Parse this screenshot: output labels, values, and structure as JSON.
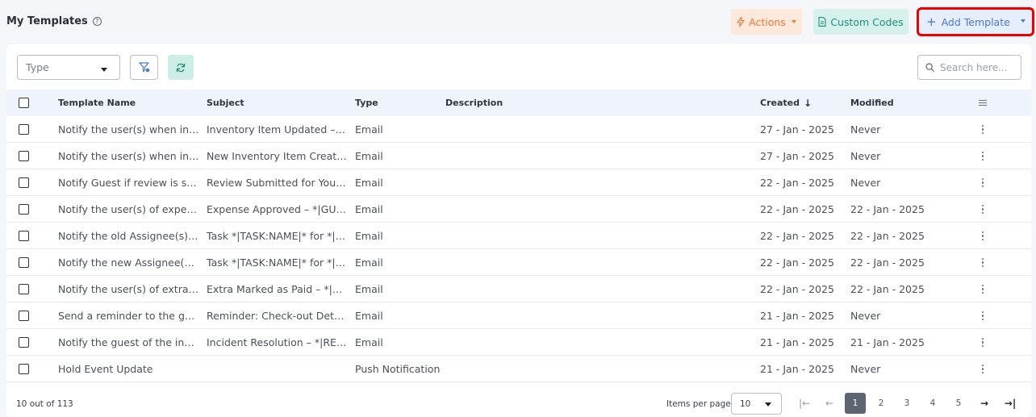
{
  "header": {
    "title": "My Templates",
    "help_glyph": "?",
    "actions_label": "Actions",
    "custom_codes_label": "Custom Codes",
    "add_template_label": "Add Template",
    "add_template_plus": "+"
  },
  "toolbar": {
    "type_placeholder": "Type",
    "search_placeholder": "Search here..."
  },
  "table": {
    "columns": {
      "name": "Template Name",
      "subject": "Subject",
      "type": "Type",
      "description": "Description",
      "created": "Created",
      "modified": "Modified"
    },
    "sort_indicator": "↓",
    "rows": [
      {
        "name": "Notify the user(s) when inve...",
        "subject": "Inventory Item Updated – *|I...",
        "type": "Email",
        "description": "",
        "created": "27 - Jan - 2025",
        "modified": "Never"
      },
      {
        "name": "Notify the user(s) when inve...",
        "subject": "New Inventory Item Created ...",
        "type": "Email",
        "description": "",
        "created": "27 - Jan - 2025",
        "modified": "Never"
      },
      {
        "name": "Notify Guest if review is sub...",
        "subject": "Review Submitted for Your St...",
        "type": "Email",
        "description": "",
        "created": "22 - Jan - 2025",
        "modified": "Never"
      },
      {
        "name": "Notify the user(s) of expense...",
        "subject": "Expense Approved – *|GUEST...",
        "type": "Email",
        "description": "",
        "created": "22 - Jan - 2025",
        "modified": "22 - Jan - 2025"
      },
      {
        "name": "Notify the old Assignee(s) w...",
        "subject": "Task *|TASK:NAME|* for *|REN...",
        "type": "Email",
        "description": "",
        "created": "22 - Jan - 2025",
        "modified": "22 - Jan - 2025"
      },
      {
        "name": "Notify the new Assignee(s) w...",
        "subject": "Task *|TASK:NAME|* for *|REN...",
        "type": "Email",
        "description": "",
        "created": "22 - Jan - 2025",
        "modified": "22 - Jan - 2025"
      },
      {
        "name": "Notify the user(s) of extra pa...",
        "subject": "Extra Marked as Paid – *|GUE...",
        "type": "Email",
        "description": "",
        "created": "22 - Jan - 2025",
        "modified": "22 - Jan - 2025"
      },
      {
        "name": "Send a reminder to the gues...",
        "subject": "Reminder: Check-out Details...",
        "type": "Email",
        "description": "",
        "created": "21 - Jan - 2025",
        "modified": "Never"
      },
      {
        "name": "Notify the guest of the incide...",
        "subject": "Incident Resolution – *|RENT...",
        "type": "Email",
        "description": "",
        "created": "21 - Jan - 2025",
        "modified": "21 - Jan - 2025"
      },
      {
        "name": "Hold Event Update",
        "subject": "",
        "type": "Push Notification",
        "description": "",
        "created": "21 - Jan - 2025",
        "modified": "Never"
      }
    ]
  },
  "footer": {
    "count_text": "10 out of 113",
    "items_per_page_label": "Items per page",
    "items_per_page_value": "10",
    "pages": [
      "1",
      "2",
      "3",
      "4",
      "5"
    ],
    "current_page": "1",
    "first_glyph": "|←",
    "prev_glyph": "←",
    "next_glyph": "→",
    "last_glyph": "→|"
  },
  "colors": {
    "actions": "#f07a3c",
    "custom_codes": "#1f8f7a",
    "add_template": "#4a76d6",
    "highlight_outline": "#e00000",
    "header_row_bg": "#eef3fc",
    "active_page_bg": "#5d6570"
  }
}
